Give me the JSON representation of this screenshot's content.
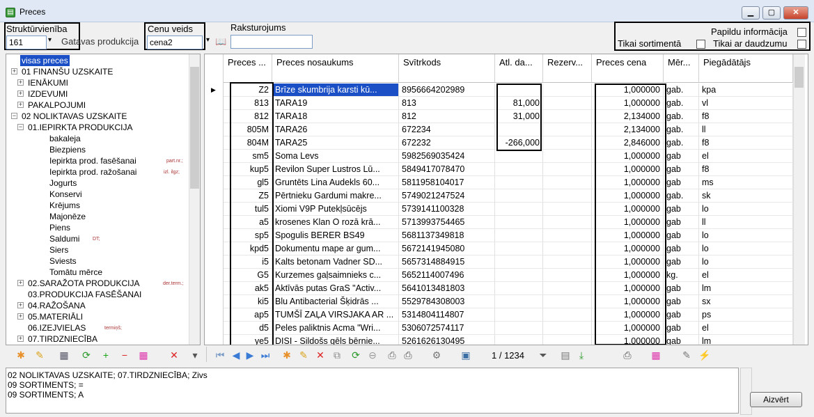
{
  "window": {
    "title": "Preces"
  },
  "filters": {
    "struktura_label": "Struktūrvienība",
    "struktura_value": "161",
    "struktura_name": "Gatavas produkcija",
    "cenu_label": "Cenu veids",
    "cenu_value": "cena2",
    "rakst_label": "Raksturojums",
    "rakst_value": "",
    "papildu_label": "Papildu informācija",
    "sortiment_label": "Tikai sortimentā",
    "daudzumu_label": "Tikai ar daudzumu"
  },
  "tree": [
    {
      "label": "visas preces",
      "note": ""
    },
    {
      "label": "01 FINANŠU UZSKAITE",
      "note": ""
    },
    {
      "label": "IENĀKUMI",
      "note": ""
    },
    {
      "label": "IZDEVUMI",
      "note": ""
    },
    {
      "label": "PAKALPOJUMI",
      "note": ""
    },
    {
      "label": "02 NOLIKTAVAS UZSKAITE",
      "note": ""
    },
    {
      "label": "01.IEPIRKTA PRODUKCIJA",
      "note": ""
    },
    {
      "label": "bakaleja",
      "note": ""
    },
    {
      "label": "Biezpiens",
      "note": ""
    },
    {
      "label": "Iepirkta prod. fasēšanai",
      "note": "part.nr.;"
    },
    {
      "label": "Iepirkta prod. ražošanai",
      "note": "izl. ilgz;"
    },
    {
      "label": "Jogurts",
      "note": ""
    },
    {
      "label": "Konservi",
      "note": ""
    },
    {
      "label": "Krējums",
      "note": ""
    },
    {
      "label": "Majonēze",
      "note": ""
    },
    {
      "label": "Piens",
      "note": ""
    },
    {
      "label": "Saldumi",
      "note": "DT;"
    },
    {
      "label": "Siers",
      "note": ""
    },
    {
      "label": "Sviests",
      "note": ""
    },
    {
      "label": "Tomātu mērce",
      "note": ""
    },
    {
      "label": "02.SARAŽOTA PRODUKCIJA",
      "note": "der.term.;"
    },
    {
      "label": "03.PRODUKCIJA FASĒŠANAI",
      "note": ""
    },
    {
      "label": "04.RAŽOŠANA",
      "note": ""
    },
    {
      "label": "05.MATERIĀLI",
      "note": ""
    },
    {
      "label": "06.IZEJVIELAS",
      "note": "termiņš;"
    },
    {
      "label": "07.TIRDZNIECĪBA",
      "note": ""
    }
  ],
  "grid": {
    "columns": [
      "Preces ...",
      "Preces nosaukums",
      "Svītrkods",
      "Atl. da...",
      "Rezerv...",
      "Preces cena",
      "Mēr...",
      "Piegādātājs"
    ],
    "rows": [
      [
        "Z2",
        "Brīze skumbrija karsti kū...",
        "8956664202989",
        "",
        "",
        "1,000000",
        "gab.",
        "kpa"
      ],
      [
        "813",
        "TARA19",
        "813",
        "81,000",
        "",
        "1,000000",
        "gab.",
        "vl"
      ],
      [
        "812",
        "TARA18",
        "812",
        "31,000",
        "",
        "2,134000",
        "gab.",
        "f8"
      ],
      [
        "805M",
        "TARA26",
        "672234",
        "",
        "",
        "2,134000",
        "gab.",
        "ll"
      ],
      [
        "804M",
        "TARA25",
        "672232",
        "-266,000",
        "",
        "2,846000",
        "gab.",
        "f8"
      ],
      [
        "sm5",
        "Soma Levs",
        "5982569035424",
        "",
        "",
        "1,000000",
        "gab",
        "el"
      ],
      [
        "kup5",
        "Revilon Super Lustros Lū...",
        "5849417078470",
        "",
        "",
        "1,000000",
        "gab",
        "f8"
      ],
      [
        "gl5",
        "Gruntēts Lina Audekls 60...",
        "5811958104017",
        "",
        "",
        "1,000000",
        "gab",
        "ms"
      ],
      [
        "Z5",
        "Pērtnieku Gardumi makre...",
        "5749021247524",
        "",
        "",
        "1,000000",
        "gab.",
        "sk"
      ],
      [
        "tul5",
        "Xiomi V9P Putekļsūcējs",
        "5739141100328",
        "",
        "",
        "1,000000",
        "gab",
        "lo"
      ],
      [
        "a5",
        "krosenes Klan O rozā krā...",
        "5713993754465",
        "",
        "",
        "1,000000",
        "gab",
        "ll"
      ],
      [
        "sp5",
        "Spogulis BERER BS49",
        "5681137349818",
        "",
        "",
        "1,000000",
        "gab",
        "lo"
      ],
      [
        "kpd5",
        "Dokumentu mape ar gum...",
        "5672141945080",
        "",
        "",
        "1,000000",
        "gab",
        "lo"
      ],
      [
        "i5",
        "Kalts betonam Vadner SD...",
        "5657314884915",
        "",
        "",
        "1,000000",
        "gab",
        "lo"
      ],
      [
        "G5",
        "Kurzemes gaļsaimnieks c...",
        "5652114007496",
        "",
        "",
        "1,000000",
        "kg.",
        "el"
      ],
      [
        "ak5",
        "Aktīvās putas GraS \"Activ...",
        "5641013481803",
        "",
        "",
        "1,000000",
        "gab",
        "lm"
      ],
      [
        "ki5",
        "Blu Antibacterial Šķidrās ...",
        "5529784308003",
        "",
        "",
        "1,000000",
        "gab",
        "sx"
      ],
      [
        "ap5",
        "TUMŠĪ ZAĻA VIRSJAKA AR ...",
        "5314804114807",
        "",
        "",
        "1,000000",
        "gab",
        "ps"
      ],
      [
        "d5",
        "Peles paliktnis Acma \"Wri...",
        "5306072574117",
        "",
        "",
        "1,000000",
        "gab",
        "el"
      ],
      [
        "ye5",
        "DISI - Sildošs gēls bērnie...",
        "5261626130495",
        "",
        "",
        "1,000000",
        "gab",
        "lm"
      ]
    ]
  },
  "pager": "1 / 1234",
  "log_lines": [
    "02 NOLIKTAVAS UZSKAITE; 07.TIRDZNIECĪBA; Zivs",
    "09 SORTIMENTS; =",
    "09 SORTIMENTS; A"
  ],
  "close_label": "Aizvērt"
}
